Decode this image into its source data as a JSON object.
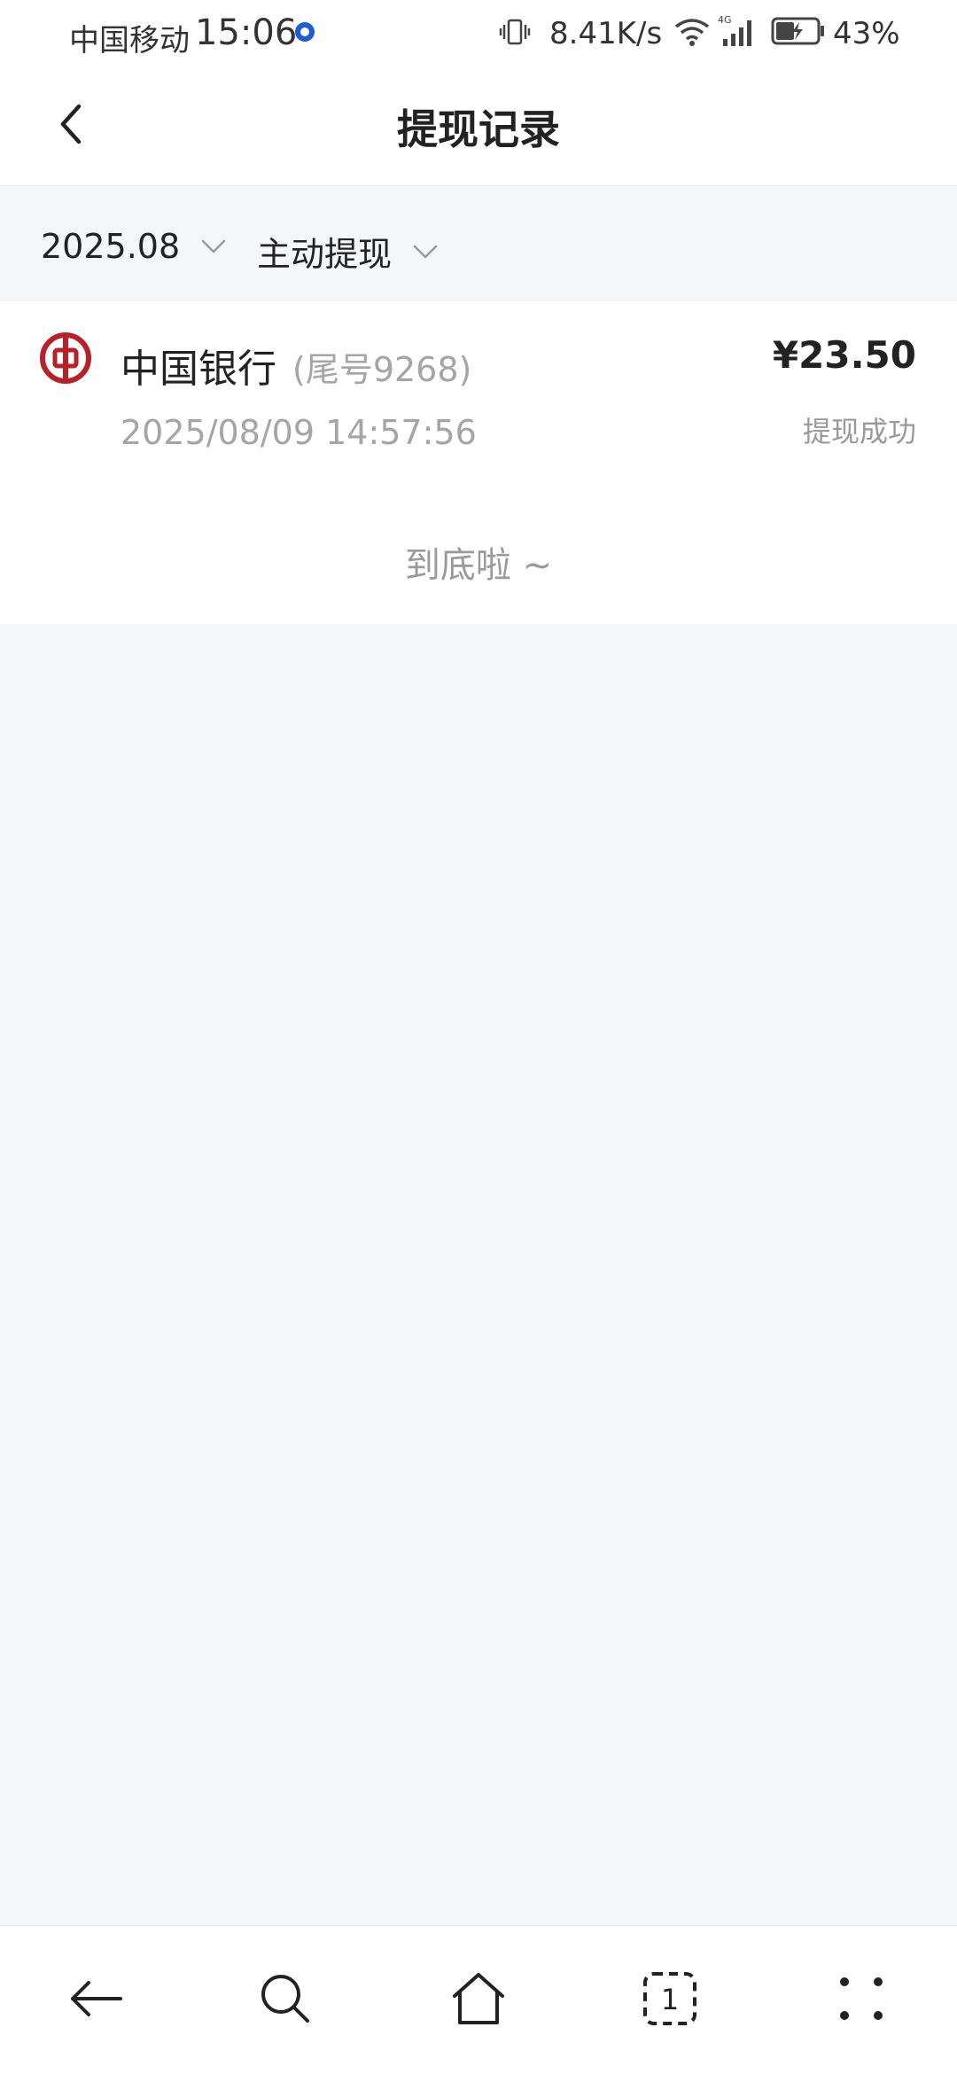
{
  "status_bar": {
    "carrier": "中国移动",
    "time": "15:06",
    "network_speed": "8.41K/s",
    "network_type": "4G",
    "battery": "43%"
  },
  "header": {
    "title": "提现记录"
  },
  "filters": {
    "month": "2025.08",
    "type": "主动提现"
  },
  "records": [
    {
      "bank": "中国银行",
      "tail": "(尾号9268)",
      "time": "2025/08/09 14:57:56",
      "amount": "¥23.50",
      "status": "提现成功"
    }
  ],
  "list_end": "到底啦 ~",
  "icons": {
    "back": "chevron-left-icon",
    "bank": "bank-of-china-logo",
    "browser_back": "arrow-left-icon",
    "search": "search-icon",
    "home": "home-icon",
    "tabs": "tab-count-icon",
    "menu": "more-dots-icon"
  },
  "tab_count": "1",
  "colors": {
    "bank_red": "#b8202a",
    "background": "#f5f6f8",
    "muted_text": "#a5a5a5"
  }
}
